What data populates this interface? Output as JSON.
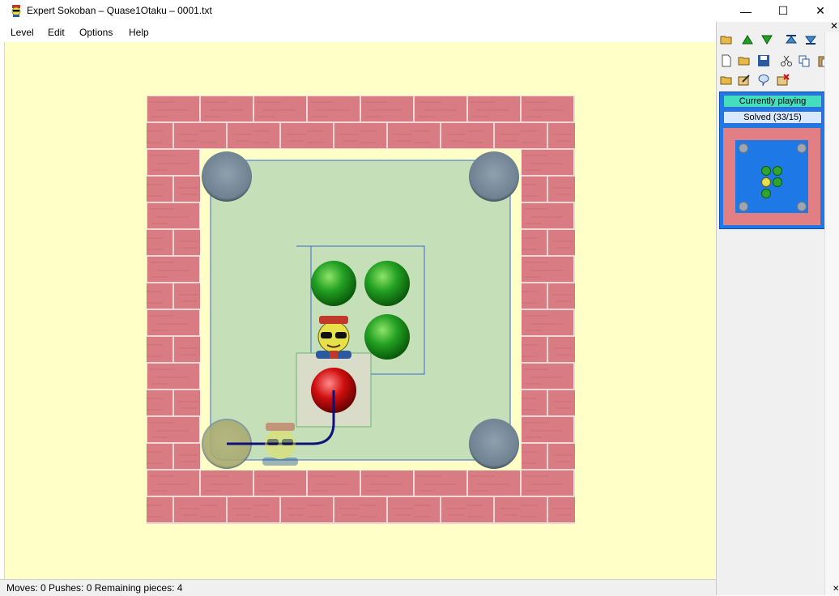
{
  "window": {
    "title": "Expert Sokoban – Quase1Otaku – 0001.txt",
    "minimize": "—",
    "maximize": "☐",
    "close": "✕"
  },
  "menu": [
    "Level",
    "Edit",
    "Options",
    "Help"
  ],
  "status": {
    "text": "Moves: 0  Pushes: 0  Remaining pieces: 4"
  },
  "side_panel": {
    "close": "✕",
    "toolbar_row1": [
      "open-icon",
      "level-up-icon",
      "level-down-icon",
      "first-level-icon",
      "last-level-icon"
    ],
    "toolbar_row2": [
      "new-icon",
      "open-folder-icon",
      "save-icon",
      "cut-icon",
      "copy-icon",
      "paste-icon"
    ],
    "toolbar_row3": [
      "folder-icon",
      "edit-icon",
      "comment-icon",
      "delete-icon"
    ],
    "level_card": {
      "playing": "Currently playing",
      "solved": "Solved (33/15)"
    }
  },
  "colors": {
    "background": "#ffffc8",
    "floor": "#c5e0b8",
    "brick": "#d97b82",
    "goal": "#6f8291",
    "gem_green": "#22a022",
    "gem_red": "#d01010",
    "path": "#10107a",
    "panel_blue": "#1e78e6"
  }
}
